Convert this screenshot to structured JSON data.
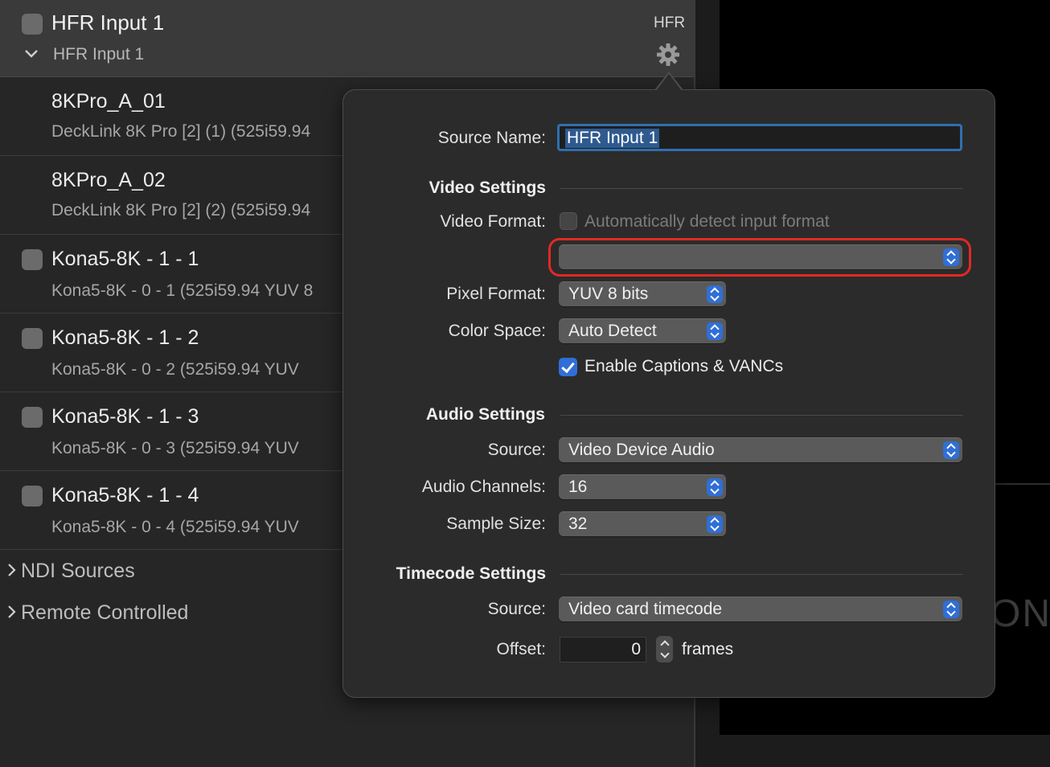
{
  "source_list": {
    "group": {
      "title": "HFR Input 1",
      "subtitle": "HFR Input 1",
      "badge": "HFR"
    },
    "items": [
      {
        "title": "8KPro_A_01",
        "subtitle": "DeckLink 8K Pro [2] (1) (525i59.94",
        "checkbox": false
      },
      {
        "title": "8KPro_A_02",
        "subtitle": "DeckLink 8K Pro [2] (2) (525i59.94",
        "checkbox": false
      },
      {
        "title": "Kona5-8K - 1 - 1",
        "subtitle": "Kona5-8K - 0 - 1 (525i59.94 YUV 8",
        "checkbox": true
      },
      {
        "title": "Kona5-8K - 1 - 2",
        "subtitle": "Kona5-8K - 0 - 2 (525i59.94 YUV",
        "checkbox": true
      },
      {
        "title": "Kona5-8K - 1 - 3",
        "subtitle": "Kona5-8K - 0 - 3 (525i59.94 YUV",
        "checkbox": true
      },
      {
        "title": "Kona5-8K - 1 - 4",
        "subtitle": "Kona5-8K - 0 - 4 (525i59.94 YUV",
        "checkbox": true
      }
    ],
    "sections": [
      {
        "label": "NDI Sources"
      },
      {
        "label": "Remote Controlled"
      }
    ]
  },
  "preview": {
    "logo_fragment": "ON"
  },
  "popover": {
    "source_name_label": "Source Name:",
    "source_name_value": "HFR Input 1",
    "video_settings": {
      "heading": "Video Settings",
      "video_format_label": "Video Format:",
      "auto_detect_label": "Automatically detect input format",
      "auto_detect_checked": false,
      "video_format_value": "",
      "pixel_format_label": "Pixel Format:",
      "pixel_format_value": "YUV 8 bits",
      "color_space_label": "Color Space:",
      "color_space_value": "Auto Detect",
      "captions_label": "Enable Captions & VANCs",
      "captions_checked": true
    },
    "audio_settings": {
      "heading": "Audio Settings",
      "source_label": "Source:",
      "source_value": "Video Device Audio",
      "channels_label": "Audio Channels:",
      "channels_value": "16",
      "sample_size_label": "Sample Size:",
      "sample_size_value": "32"
    },
    "timecode_settings": {
      "heading": "Timecode Settings",
      "source_label": "Source:",
      "source_value": "Video card timecode",
      "offset_label": "Offset:",
      "offset_value": "0",
      "offset_unit": "frames"
    }
  },
  "colors": {
    "accent": "#2f6fd6",
    "highlight_ring": "#e02a23",
    "popover_bg": "#2b2b2b",
    "list_bg": "#262626"
  }
}
